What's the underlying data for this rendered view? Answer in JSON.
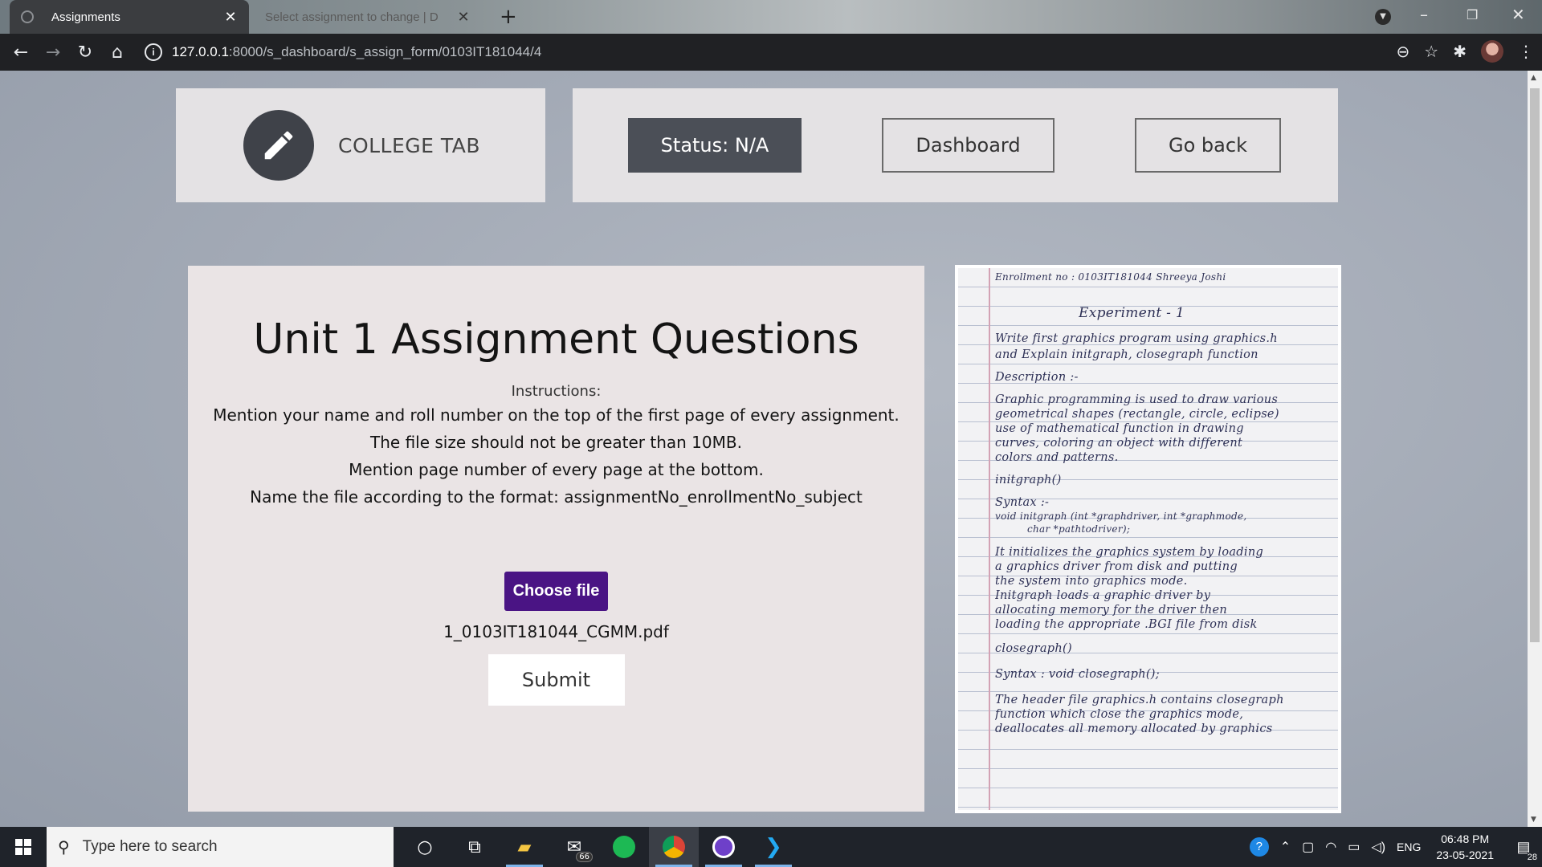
{
  "browser": {
    "tabs": [
      {
        "title": "Assignments",
        "active": true
      },
      {
        "title": "Select assignment to change | D",
        "active": false
      }
    ],
    "url_host": "127.0.0.1",
    "url_path": ":8000/s_dashboard/s_assign_form/0103IT181044/4"
  },
  "header": {
    "brand": "COLLEGE TAB",
    "status_label": "Status: N/A",
    "dashboard_label": "Dashboard",
    "back_label": "Go back"
  },
  "form": {
    "title": "Unit 1 Assignment Questions",
    "instructions_label": "Instructions:",
    "instructions": [
      "Mention your name and roll number on the top of the first page of every assignment.",
      "The file size should not be greater than 10MB.",
      "Mention page number of every page at the bottom.",
      "Name the file according to the format: assignmentNo_enrollmentNo_subject"
    ],
    "choose_file_label": "Choose file",
    "selected_file": "1_0103IT181044_CGMM.pdf",
    "submit_label": "Submit"
  },
  "question_sheet": {
    "lines": [
      "Enrollment no : 0103IT181044          Shreeya Joshi",
      "Experiment - 1",
      "Write first graphics program using graphics.h",
      "and Explain initgraph, closegraph function",
      "Description :-",
      "Graphic programming is used to draw various",
      "geometrical shapes (rectangle, circle, eclipse)",
      "use of mathematical function in drawing",
      "curves, coloring an object with different",
      "colors and patterns.",
      "initgraph()",
      "Syntax :-",
      "void initgraph (int *graphdriver, int *graphmode,",
      "char *pathtodriver);",
      "It initializes the graphics system by loading",
      "a graphics driver from disk and putting",
      "the system into graphics mode.",
      "Initgraph loads a graphic driver by",
      "allocating memory for the driver then",
      "loading the appropriate .BGI file from disk",
      "closegraph()",
      "Syntax :  void closegraph();",
      "The header file graphics.h contains closegraph",
      "function which close the graphics mode,",
      "deallocates all memory allocated by graphics"
    ]
  },
  "taskbar": {
    "search_placeholder": "Type here to search",
    "mail_badge": "66",
    "language": "ENG",
    "time": "06:48 PM",
    "date": "23-05-2021",
    "notifications": "28"
  },
  "colors": {
    "choose_button": "#4a1484",
    "status_button": "#4b4f57",
    "card": "#eae4e5"
  }
}
